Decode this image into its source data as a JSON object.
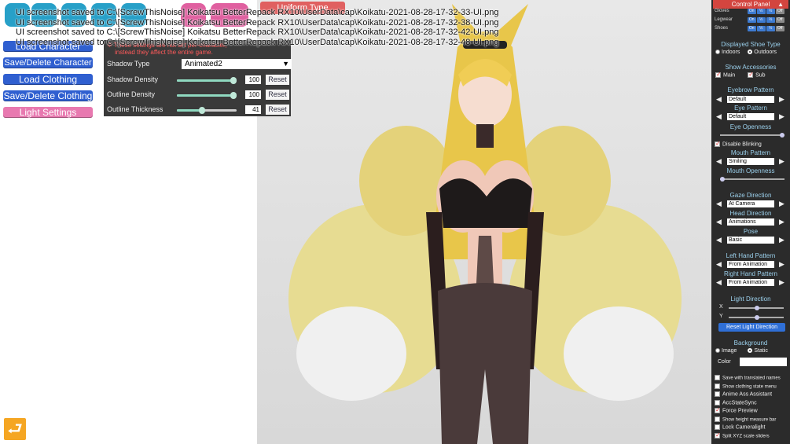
{
  "log_lines": [
    "UI screenshot saved to C:\\[ScrewThisNoise] Koikatsu BetterRepack RX10\\UserData\\cap\\Koikatu-2021-08-28-17-32-33-UI.png",
    "UI screenshot saved to C:\\[ScrewThisNoise] Koikatsu BetterRepack RX10\\UserData\\cap\\Koikatu-2021-08-28-17-32-38-UI.png",
    "UI screenshot saved to C:\\[ScrewThisNoise] Koikatsu BetterRepack RX10\\UserData\\cap\\Koikatu-2021-08-28-17-32-42-UI.png",
    "UI screenshot saved to C:\\[ScrewThisNoise] Koikatsu BetterRepack RX10\\UserData\\cap\\Koikatu-2021-08-28-17-32-48-UI.png"
  ],
  "top_bar": {
    "uniform_label": "Uniform Type"
  },
  "left_menu": {
    "load_character": "Load Character",
    "save_delete_character": "Save/Delete Character",
    "load_clothing": "Load Clothing",
    "save_delete_clothing": "Save/Delete Clothing",
    "light_settings": "Light Settings"
  },
  "shadow_panel": {
    "warning_line1": "※ These settings are not set per-character,",
    "warning_line2": "instead they affect the entire game.",
    "shadow_type_label": "Shadow Type",
    "shadow_type_value": "Animated2",
    "dropdown_glyph": "▼",
    "rows": [
      {
        "label": "Shadow Density",
        "value": "100",
        "fraction": 1.0
      },
      {
        "label": "Outline Density",
        "value": "100",
        "fraction": 1.0
      },
      {
        "label": "Outline Thickness",
        "value": "41",
        "fraction": 0.41
      }
    ],
    "reset_label": "Reset"
  },
  "control_panel": {
    "title": "Control Panel",
    "title_arrow": "▲",
    "clothing_rows": [
      {
        "label": "Gloves",
        "pills": [
          "On",
          "½",
          "½",
          "Off"
        ]
      },
      {
        "label": "Legwear",
        "pills": [
          "On",
          "½",
          "½",
          "Off"
        ]
      },
      {
        "label": "Shoes",
        "pills": [
          "On",
          "½",
          "½",
          "Off"
        ]
      }
    ],
    "displayed_shoe_type": "Displayed Shoe Type",
    "indoors": "Indoors",
    "outdoors": "Outdoors",
    "show_accessories": "Show Accessories",
    "main": "Main",
    "sub": "Sub",
    "eyebrow_pattern": "Eyebrow Pattern",
    "eyebrow_value": "Default",
    "eye_pattern": "Eye Pattern",
    "eye_value": "Default",
    "eye_openness": "Eye Openness",
    "disable_blinking": "Disable Blinking",
    "mouth_pattern": "Mouth Pattern",
    "mouth_value": "Smiling",
    "mouth_openness": "Mouth Openness",
    "gaze_direction": "Gaze Direction",
    "gaze_value": "At Camera",
    "head_direction": "Head Direction",
    "head_value": "Animations",
    "pose": "Pose",
    "pose_value": "Basic",
    "left_hand": "Left Hand Pattern",
    "left_hand_value": "From Animation",
    "right_hand": "Right Hand Pattern",
    "right_hand_value": "From Animation",
    "light_direction": "Light Direction",
    "x_label": "X",
    "y_label": "Y",
    "reset_light": "Reset Light Direction",
    "background": "Background",
    "image": "Image",
    "static": "Static",
    "color": "Color",
    "arrow_left": "◀",
    "arrow_right": "▶",
    "options": [
      {
        "label": "Save with translated names",
        "checked": false
      },
      {
        "label": "Show clothing state menu",
        "checked": false
      },
      {
        "label": "Anime Ass Assistant",
        "checked": false
      },
      {
        "label": "AccStateSync",
        "checked": false
      },
      {
        "label": "Force Preview",
        "checked": true
      },
      {
        "label": "Show height measure bar",
        "checked": false
      },
      {
        "label": "Lock Cameralight",
        "checked": false
      },
      {
        "label": "Split XYZ scale sliders",
        "checked": true
      }
    ]
  },
  "back_icon": "⮐",
  "colors": {
    "accent_blue": "#2f5fd0",
    "accent_pink": "#e879b0",
    "panel_red": "#d3453f"
  }
}
